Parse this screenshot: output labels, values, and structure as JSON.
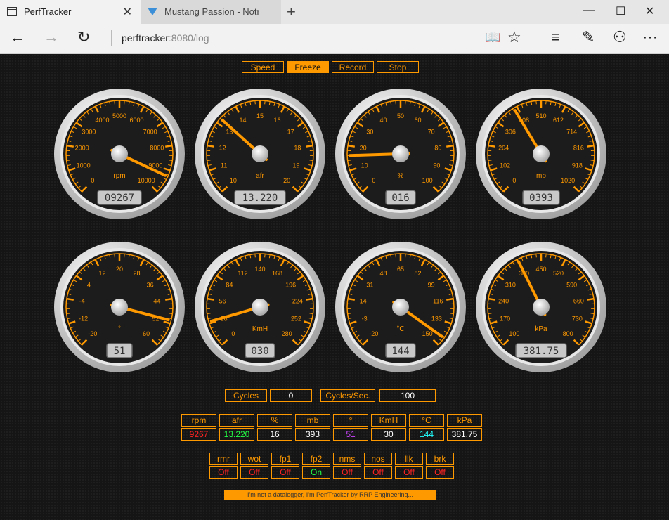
{
  "browser": {
    "tabs": [
      {
        "title": "PerfTracker"
      },
      {
        "title": "Mustang Passion - Notre Pas"
      }
    ],
    "address": {
      "host": "perftracker",
      "rest": ":8080/log"
    }
  },
  "controls": [
    "Speed",
    "Freeze",
    "Record",
    "Stop"
  ],
  "active_control": "Freeze",
  "gauges": [
    {
      "unit": "rpm",
      "ticks": [
        "0",
        "1000",
        "2000",
        "3000",
        "4000",
        "5000",
        "6000",
        "7000",
        "8000",
        "9000",
        "10000"
      ],
      "min": 0,
      "max": 10000,
      "value": 9267,
      "display": "09267"
    },
    {
      "unit": "afr",
      "ticks": [
        "10",
        "11",
        "12",
        "13",
        "14",
        "15",
        "16",
        "17",
        "18",
        "19",
        "20"
      ],
      "min": 10,
      "max": 20,
      "value": 13.22,
      "display": "13.220"
    },
    {
      "unit": "%",
      "ticks": [
        "0",
        "10",
        "20",
        "30",
        "40",
        "50",
        "60",
        "70",
        "80",
        "90",
        "100"
      ],
      "min": 0,
      "max": 100,
      "value": 16,
      "display": "016"
    },
    {
      "unit": "mb",
      "ticks": [
        "0",
        "102",
        "204",
        "306",
        "408",
        "510",
        "612",
        "714",
        "816",
        "918",
        "1020"
      ],
      "min": 0,
      "max": 1020,
      "value": 393,
      "display": "0393"
    },
    {
      "unit": "°",
      "ticks": [
        "-20",
        "-12",
        "-4",
        "4",
        "12",
        "20",
        "28",
        "36",
        "44",
        "52",
        "60"
      ],
      "min": -20,
      "max": 60,
      "value": 51,
      "display": "51"
    },
    {
      "unit": "KmH",
      "ticks": [
        "0",
        "28",
        "56",
        "84",
        "112",
        "140",
        "168",
        "196",
        "224",
        "252",
        "280"
      ],
      "min": 0,
      "max": 280,
      "value": 30,
      "display": "030"
    },
    {
      "unit": "°C",
      "ticks": [
        "-20",
        "-3",
        "14",
        "31",
        "48",
        "65",
        "82",
        "99",
        "116",
        "133",
        "150"
      ],
      "min": -20,
      "max": 150,
      "value": 144,
      "display": "144"
    },
    {
      "unit": "kPa",
      "ticks": [
        "100",
        "170",
        "240",
        "310",
        "380",
        "450",
        "520",
        "590",
        "660",
        "730",
        "800"
      ],
      "min": 100,
      "max": 800,
      "value": 381.75,
      "display": "381.75"
    }
  ],
  "cycles": {
    "label": "Cycles",
    "value": "0",
    "rate_label": "Cycles/Sec.",
    "rate_value": "100"
  },
  "table": {
    "headers": [
      "rpm",
      "afr",
      "%",
      "mb",
      "°",
      "KmH",
      "°C",
      "kPa"
    ],
    "values": [
      "9267",
      "13.220",
      "16",
      "393",
      "51",
      "30",
      "144",
      "381.75"
    ],
    "colors": [
      "#ff2222",
      "#22ff44",
      "#ffffff",
      "#ffffff",
      "#cc44ff",
      "#ffffff",
      "#22ffff",
      "#ffffff"
    ]
  },
  "flags": {
    "names": [
      "rmr",
      "wot",
      "fp1",
      "fp2",
      "nms",
      "nos",
      "llk",
      "brk"
    ],
    "states": [
      "Off",
      "Off",
      "Off",
      "On",
      "Off",
      "Off",
      "Off",
      "Off"
    ],
    "colors": {
      "Off": "#ff2222",
      "On": "#22ff44"
    }
  },
  "footer": "I'm not a datalogger, I'm PerfTracker by RRP Engineering...",
  "colors": {
    "accent": "#ff9900",
    "background": "#151515"
  }
}
